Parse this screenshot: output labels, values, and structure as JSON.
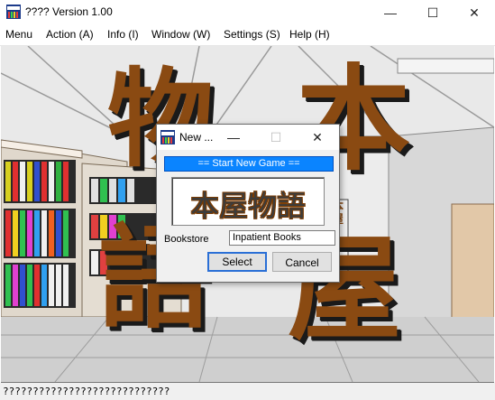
{
  "window": {
    "title": "???? Version 1.00",
    "minimize_glyph": "—",
    "maximize_glyph": "☐",
    "close_glyph": "✕"
  },
  "menu": [
    "Menu",
    "Action (A)",
    "Info (I)",
    "Window (W)",
    "Settings (S)",
    "Help (H)"
  ],
  "scene": {
    "big_chars": [
      "物",
      "本",
      "語",
      "屋"
    ],
    "shelf_sign": "本屋"
  },
  "dialog": {
    "title": "New ...",
    "minimize_glyph": "—",
    "maximize_glyph": "☐",
    "close_glyph": "✕",
    "banner": "== Start New Game  ==",
    "logo": "本屋物語",
    "bookstore_label": "Bookstore",
    "bookstore_value": "Inpatient Books",
    "select_label": "Select",
    "cancel_label": "Cancel"
  },
  "status": "????????????????????????????",
  "colors": {
    "accent": "#0a84ff",
    "title_char": "#8a4a12"
  }
}
